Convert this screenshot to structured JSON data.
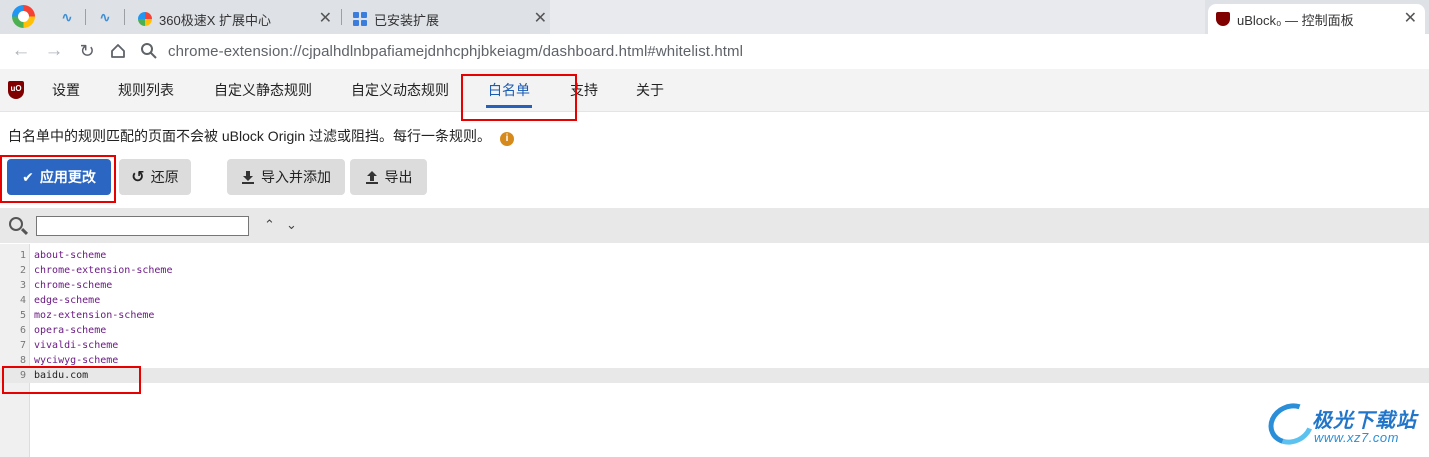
{
  "browser": {
    "tabs": [
      {
        "title": "360极速X 扩展中心"
      },
      {
        "title": "已安装扩展"
      },
      {
        "title": "uBlock₀ — 控制面板"
      }
    ],
    "url": "chrome-extension://cjpalhdlnbpafiamejdnhcphjbkeiagm/dashboard.html#whitelist.html"
  },
  "dashboard": {
    "logo_text": "uO",
    "tabs": [
      "设置",
      "规则列表",
      "自定义静态规则",
      "自定义动态规则",
      "白名单",
      "支持",
      "关于"
    ],
    "selected_tab": "白名单"
  },
  "whitelist": {
    "description": "白名单中的规则匹配的页面不会被 uBlock Origin 过滤或阻挡。每行一条规则。",
    "buttons": {
      "apply": "应用更改",
      "revert": "还原",
      "import": "导入并添加",
      "export": "导出"
    },
    "search_value": "",
    "lines": [
      {
        "num": "1",
        "text": "about-scheme"
      },
      {
        "num": "2",
        "text": "chrome-extension-scheme"
      },
      {
        "num": "3",
        "text": "chrome-scheme"
      },
      {
        "num": "4",
        "text": "edge-scheme"
      },
      {
        "num": "5",
        "text": "moz-extension-scheme"
      },
      {
        "num": "6",
        "text": "opera-scheme"
      },
      {
        "num": "7",
        "text": "vivaldi-scheme"
      },
      {
        "num": "8",
        "text": "wyciwyg-scheme"
      },
      {
        "num": "9",
        "text": "baidu.com"
      }
    ]
  },
  "watermark": {
    "title": "极光下载站",
    "url": "www.xz7.com"
  },
  "colors": {
    "accent": "#2a66c2",
    "highlight_box": "#e60000",
    "rule_text": "#6b1b84",
    "ubo_brand": "#800000"
  }
}
